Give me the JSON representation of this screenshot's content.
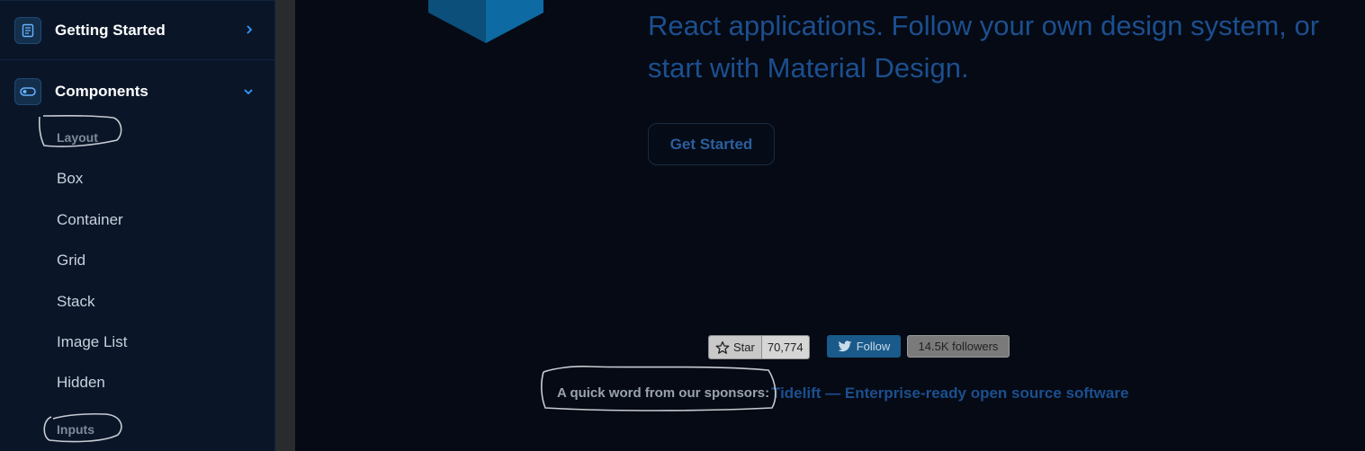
{
  "sidebar": {
    "sections": [
      {
        "label": "Getting Started",
        "icon": "document-icon",
        "chevron": "›"
      },
      {
        "label": "Components",
        "icon": "toggle-icon",
        "chevron": "⌄"
      }
    ],
    "components": {
      "groups": [
        {
          "header": "Layout",
          "items": [
            "Box",
            "Container",
            "Grid",
            "Stack",
            "Image List",
            "Hidden"
          ]
        },
        {
          "header": "Inputs",
          "items": []
        }
      ]
    }
  },
  "hero": {
    "line1": "React applications. Follow your own design system, or",
    "line2": "start with Material Design.",
    "cta_label": "Get Started"
  },
  "social": {
    "star_label": "Star",
    "star_count": "70,774",
    "follow_label": "Follow",
    "followers": "14.5K followers"
  },
  "sponsors": {
    "label": "A quick word from our sponsors:",
    "link_text": "Tidelift — Enterprise-ready open source software"
  },
  "colors": {
    "sidebar_bg": "#0a1628",
    "main_bg": "#050a14",
    "accent": "#3399ff",
    "cube": "#0b5a8c"
  }
}
